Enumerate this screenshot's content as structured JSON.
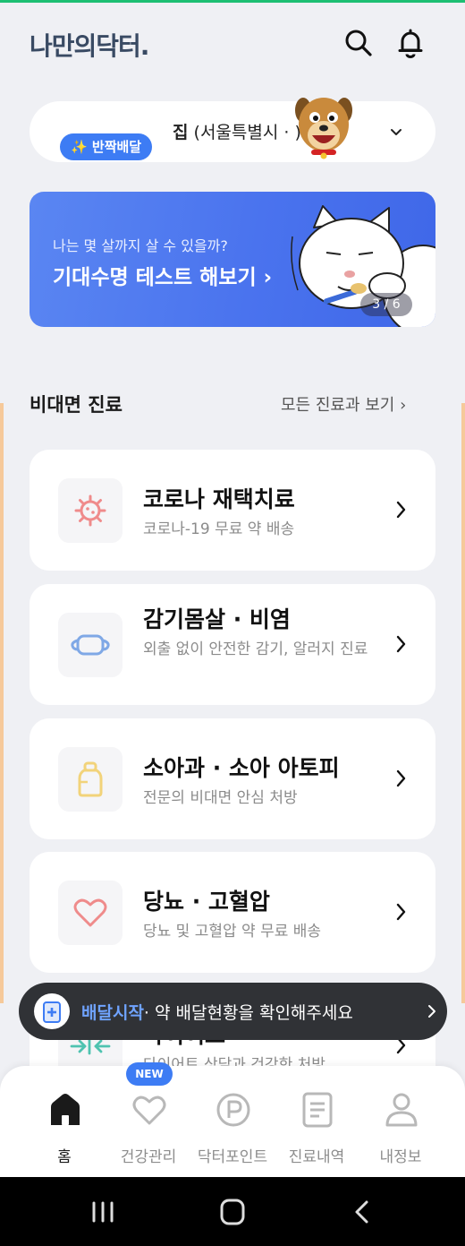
{
  "app": {
    "logo_text": "나만의닥터."
  },
  "header": {
    "search_icon": "search-icon",
    "bell_icon": "bell-icon"
  },
  "address": {
    "badge": "✨ 반짝배달",
    "label": "집",
    "detail": "(서울특별시 ·",
    "detail_end": ")"
  },
  "banner": {
    "subtitle": "나는 몇 살까지 살 수 있을까?",
    "title": "기대수명 테스트 해보기 ›",
    "pager": "3 / 6"
  },
  "section": {
    "title": "비대면 진료",
    "more_link": "모든 진료과 보기 ›"
  },
  "cards": [
    {
      "title": "코로나 재택치료",
      "subtitle": "코로나-19 무료 약 배송",
      "icon": "virus-icon"
    },
    {
      "title": "감기몸살 · 비염",
      "subtitle": "외출 없이 안전한 감기, 알러지 진료",
      "icon": "mask-icon"
    },
    {
      "title": "소아과 · 소아 아토피",
      "subtitle": "전문의 비대면 안심 처방",
      "icon": "baby-bottle-icon"
    },
    {
      "title": "당뇨 · 고혈압",
      "subtitle": "당뇨 및 고혈압 약 무료 배송",
      "icon": "heart-icon"
    },
    {
      "title": "다이어트",
      "subtitle": "다이어트 상담과 건강한 처방",
      "icon": "arrows-in-icon"
    }
  ],
  "toast": {
    "highlight": "배달시작",
    "message": "· 약 배달현황을 확인해주세요"
  },
  "nav": {
    "new_badge": "NEW",
    "items": [
      {
        "label": "홈",
        "icon": "home-icon"
      },
      {
        "label": "건강관리",
        "icon": "heart-outline-icon"
      },
      {
        "label": "닥터포인트",
        "icon": "point-icon"
      },
      {
        "label": "진료내역",
        "icon": "document-icon"
      },
      {
        "label": "내정보",
        "icon": "person-icon"
      }
    ]
  },
  "colors": {
    "accent": "#3d7cf4",
    "banner": "#4a73ee",
    "toast_bg": "#303236"
  }
}
